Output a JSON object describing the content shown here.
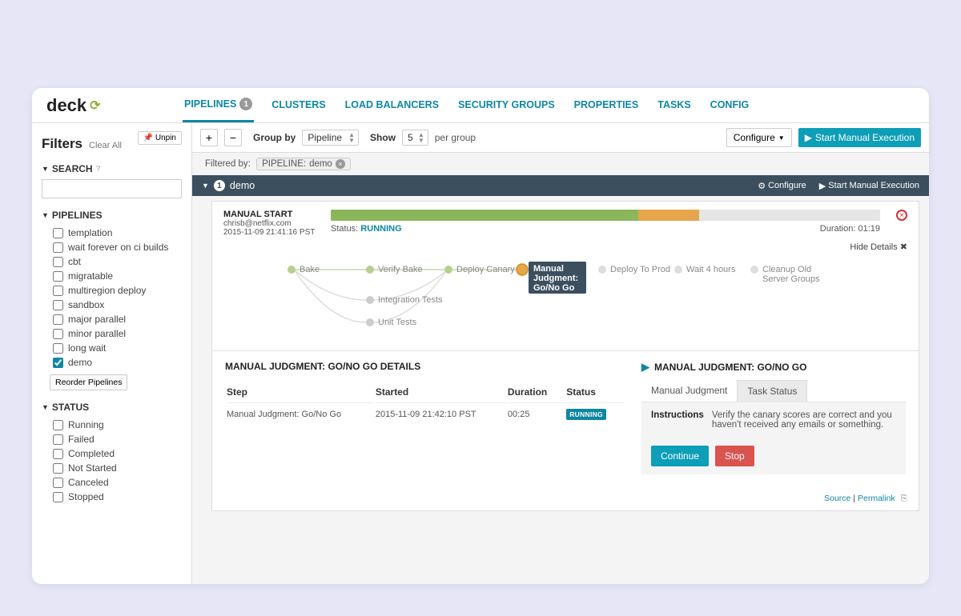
{
  "logo": "deck",
  "nav": {
    "pipelines": "PIPELINES",
    "pipelines_badge": "1",
    "clusters": "CLUSTERS",
    "load_balancers": "LOAD BALANCERS",
    "security_groups": "SECURITY GROUPS",
    "properties": "PROPERTIES",
    "tasks": "TASKS",
    "config": "CONFIG"
  },
  "sidebar": {
    "unpin": "Unpin",
    "filters_title": "Filters",
    "clear_all": "Clear All",
    "search_label": "SEARCH",
    "pipelines_label": "PIPELINES",
    "pipeline_items": [
      {
        "label": "templation",
        "checked": false
      },
      {
        "label": "wait forever on ci builds",
        "checked": false
      },
      {
        "label": "cbt",
        "checked": false
      },
      {
        "label": "migratable",
        "checked": false
      },
      {
        "label": "multiregion deploy",
        "checked": false
      },
      {
        "label": "sandbox",
        "checked": false
      },
      {
        "label": "major parallel",
        "checked": false
      },
      {
        "label": "minor parallel",
        "checked": false
      },
      {
        "label": "long wait",
        "checked": false
      },
      {
        "label": "demo",
        "checked": true
      }
    ],
    "reorder": "Reorder Pipelines",
    "status_label": "STATUS",
    "status_items": [
      {
        "label": "Running"
      },
      {
        "label": "Failed"
      },
      {
        "label": "Completed"
      },
      {
        "label": "Not Started"
      },
      {
        "label": "Canceled"
      },
      {
        "label": "Stopped"
      }
    ]
  },
  "toolbar": {
    "group_by": "Group by",
    "group_by_value": "Pipeline",
    "show": "Show",
    "show_value": "5",
    "per_group": "per group",
    "configure": "Configure",
    "start_exec": "Start Manual Execution"
  },
  "filtered_by": {
    "label": "Filtered by:",
    "chip_key": "PIPELINE:",
    "chip_val": "demo"
  },
  "pipeline_header": {
    "badge": "1",
    "name": "demo",
    "configure": "Configure",
    "start": "Start Manual Execution"
  },
  "execution": {
    "title": "MANUAL START",
    "user": "chrisb@netflix.com",
    "timestamp": "2015-11-09 21:41:16 PST",
    "status_label": "Status:",
    "status_value": "RUNNING",
    "duration_label": "Duration:",
    "duration_value": "01:19",
    "hide_details": "Hide Details",
    "progress": {
      "green_pct": 56,
      "orange_pct": 11
    }
  },
  "stages": {
    "s0": "Bake",
    "s1": "Verify Bake",
    "s2": "Deploy Canary",
    "s3a": "Manual",
    "s3b": "Judgment:",
    "s3c": "Go/No Go",
    "s4": "Deploy To Prod",
    "s5": "Wait 4 hours",
    "s6a": "Cleanup Old",
    "s6b": "Server Groups",
    "s7": "Integration Tests",
    "s8": "Unit Tests"
  },
  "details": {
    "left_title": "MANUAL JUDGMENT: GO/NO GO DETAILS",
    "cols": {
      "step": "Step",
      "started": "Started",
      "duration": "Duration",
      "status": "Status"
    },
    "row": {
      "step": "Manual Judgment: Go/No Go",
      "started": "2015-11-09 21:42:10 PST",
      "duration": "00:25",
      "status": "RUNNING"
    },
    "right_title": "MANUAL JUDGMENT: GO/NO GO",
    "tabs": {
      "manual": "Manual Judgment",
      "task": "Task Status"
    },
    "instr_label": "Instructions",
    "instr_text": "Verify the canary scores are correct and you haven't received any emails or something.",
    "btn_continue": "Continue",
    "btn_stop": "Stop"
  },
  "footer": {
    "source": "Source",
    "permalink": "Permalink"
  }
}
